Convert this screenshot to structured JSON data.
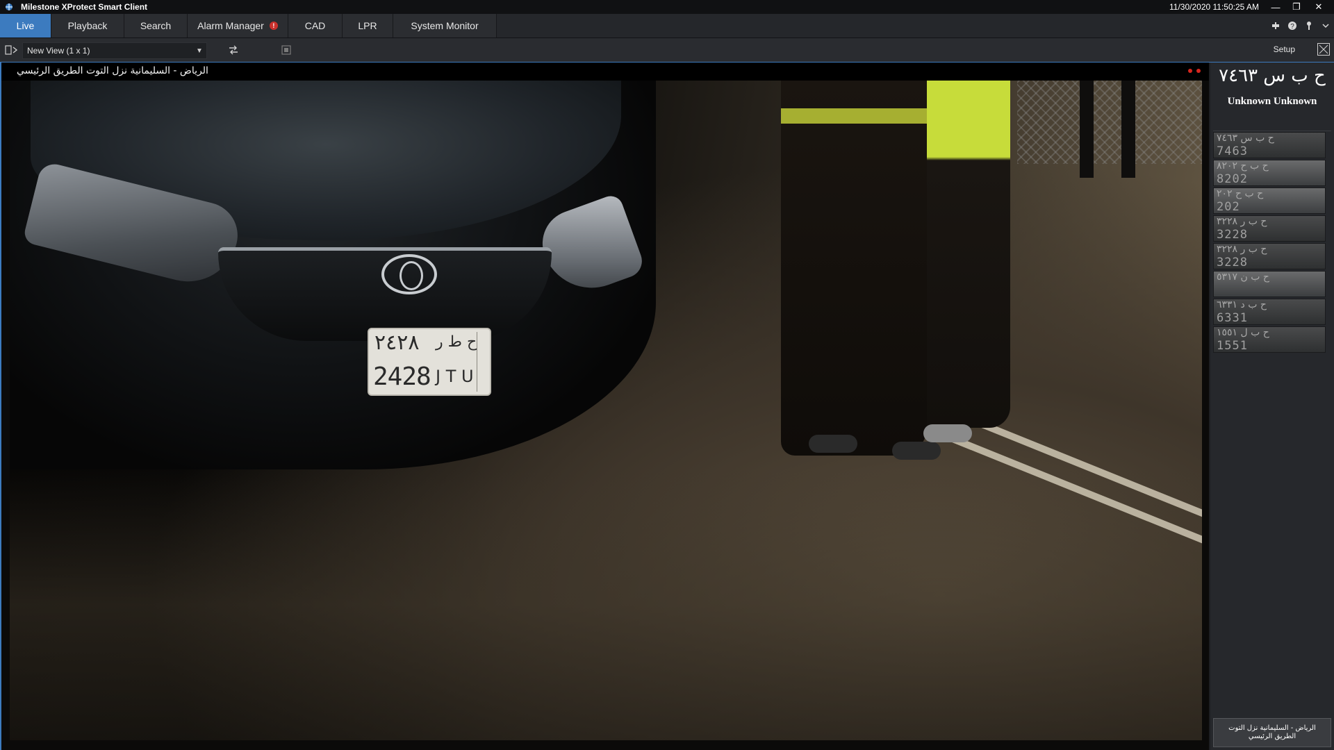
{
  "window": {
    "title": "Milestone XProtect Smart Client",
    "datetime": "11/30/2020 11:50:25 AM",
    "controls": {
      "minimize": "—",
      "restore": "❐",
      "close": "✕"
    }
  },
  "tabs": [
    {
      "label": "Live",
      "active": true
    },
    {
      "label": "Playback"
    },
    {
      "label": "Search"
    },
    {
      "label": "Alarm Manager",
      "badge": "!"
    },
    {
      "label": "CAD"
    },
    {
      "label": "LPR"
    },
    {
      "label": "System Monitor"
    }
  ],
  "toolbar": {
    "view_selector": "New View (1 x 1)",
    "setup_label": "Setup"
  },
  "camera": {
    "name": "الرياض - السليمانية نزل التوت الطريق الرئيسي"
  },
  "vehicle_plate": {
    "arabic_numbers": "٢٤٢٨",
    "arabic_letters": "ح ط ر",
    "latin_numbers": "2428",
    "latin_letters": "J T U"
  },
  "lpr": {
    "plate_text": "ح ب س ٧٤٦٣",
    "owner": "Unknown Unknown",
    "thumbnails": [
      {
        "top": "ح ب س ٧٤٦٣",
        "bottom": "7463"
      },
      {
        "top": "ح ب ح ٨٢٠٢",
        "bottom": "8202"
      },
      {
        "top": "ح ب ح ٢٠٢",
        "bottom": "202"
      },
      {
        "top": "ح ب ر ٣٢٢٨",
        "bottom": "3228"
      },
      {
        "top": "ح ب ر ٣٢٢٨",
        "bottom": "3228"
      },
      {
        "top": "ح ب ن ٥٣١٧",
        "bottom": ""
      },
      {
        "top": "ح ب د ٦٣٣١",
        "bottom": "6331"
      },
      {
        "top": "ح ب ل ١٥٥١",
        "bottom": "1551"
      }
    ],
    "camera_footer": "الرياض - السليمانية نزل التوت الطريق الرئيسي"
  },
  "colors": {
    "accent": "#3c7bbf",
    "alarm": "#c9302c",
    "recording": "#d7261e"
  }
}
